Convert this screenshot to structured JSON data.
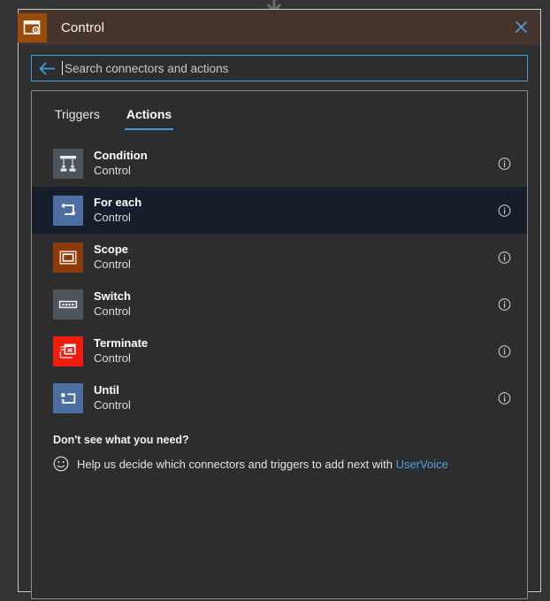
{
  "window": {
    "title": "Control",
    "icon": "control-connector-icon",
    "close_label": "✕",
    "accent_color": "#9a4b0a",
    "titlebar_color": "#45352c"
  },
  "search": {
    "back_icon": "back-arrow-icon",
    "placeholder": "Search connectors and actions",
    "value": "",
    "border_color": "#3d9ce0"
  },
  "tabs": [
    {
      "label": "Triggers",
      "active": false
    },
    {
      "label": "Actions",
      "active": true
    }
  ],
  "actions": [
    {
      "title": "Condition",
      "subtitle": "Control",
      "icon": "condition-icon",
      "tile_color": "#4c545e",
      "selected": false,
      "info_icon": "info-icon"
    },
    {
      "title": "For each",
      "subtitle": "Control",
      "icon": "for-each-icon",
      "tile_color": "#4a6fa0",
      "selected": true,
      "info_icon": "info-icon"
    },
    {
      "title": "Scope",
      "subtitle": "Control",
      "icon": "scope-icon",
      "tile_color": "#8a3b08",
      "selected": false,
      "info_icon": "info-icon"
    },
    {
      "title": "Switch",
      "subtitle": "Control",
      "icon": "switch-icon",
      "tile_color": "#4c545e",
      "selected": false,
      "info_icon": "info-icon"
    },
    {
      "title": "Terminate",
      "subtitle": "Control",
      "icon": "terminate-icon",
      "tile_color": "#f01c0e",
      "selected": false,
      "info_icon": "info-icon"
    },
    {
      "title": "Until",
      "subtitle": "Control",
      "icon": "until-icon",
      "tile_color": "#4a6fa0",
      "selected": false,
      "info_icon": "info-icon"
    }
  ],
  "footer": {
    "heading": "Don't see what you need?",
    "smiley_icon": "smiley-icon",
    "text_before": "Help us decide which connectors and triggers to add next with",
    "link_label": "UserVoice",
    "link_color": "#4da3e3"
  }
}
